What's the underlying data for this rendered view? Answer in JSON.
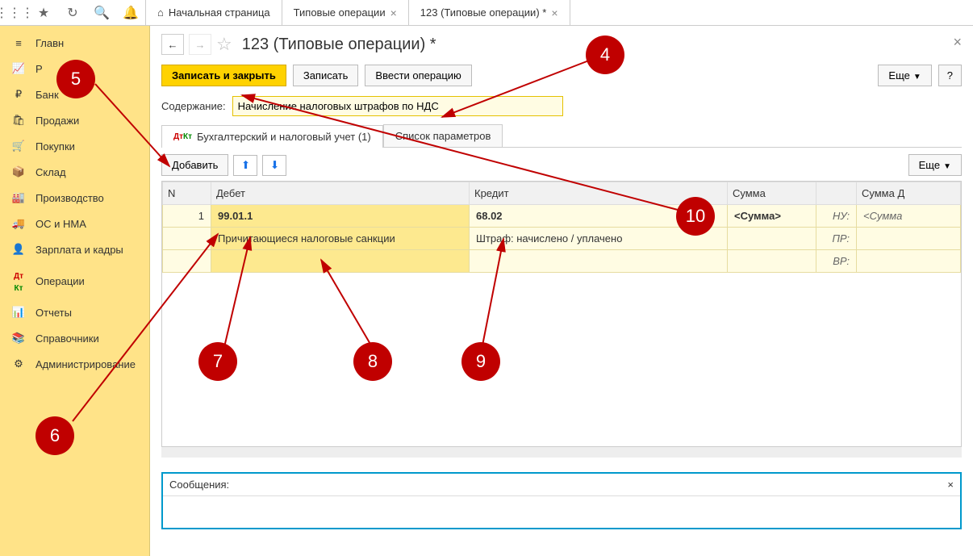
{
  "tabs": {
    "home": "Начальная страница",
    "tab1": "Типовые операции",
    "tab2": "123 (Типовые операции) *"
  },
  "sidebar": {
    "items": [
      {
        "icon": "≡",
        "label": "Главн"
      },
      {
        "icon": "~",
        "label": "Р"
      },
      {
        "icon": "₽",
        "label": "Банк"
      },
      {
        "icon": "🛍",
        "label": "Продажи"
      },
      {
        "icon": "🛒",
        "label": "Покупки"
      },
      {
        "icon": "📦",
        "label": "Склад"
      },
      {
        "icon": "🏭",
        "label": "Производство"
      },
      {
        "icon": "🚚",
        "label": "ОС и НМА"
      },
      {
        "icon": "👤",
        "label": "Зарплата и кадры"
      },
      {
        "icon": "ДтКт",
        "label": "Операции"
      },
      {
        "icon": "📊",
        "label": "Отчеты"
      },
      {
        "icon": "📚",
        "label": "Справочники"
      },
      {
        "icon": "⚙",
        "label": "Администрирование"
      }
    ]
  },
  "page": {
    "title": "123 (Типовые операции) *",
    "save_close": "Записать и закрыть",
    "save": "Записать",
    "enter_op": "Ввести операцию",
    "more": "Еще",
    "content_label": "Содержание:",
    "content_value": "Начисление налоговых штрафов по НДС",
    "tab_accounting": "Бухгалтерский и налоговый учет (1)",
    "tab_params": "Список параметров",
    "add": "Добавить",
    "headers": {
      "n": "N",
      "debit": "Дебет",
      "credit": "Кредит",
      "sum": "Сумма",
      "sumd": "Сумма Д"
    },
    "row": {
      "n": "1",
      "debit_acc": "99.01.1",
      "debit_sub": "Причитающиеся налоговые санкции",
      "credit_acc": "68.02",
      "credit_sub": "Штраф: начислено / уплачено",
      "sum": "<Сумма>",
      "nu": "НУ:",
      "pr": "ПР:",
      "vr": "ВР:",
      "sumd": "<Сумма"
    },
    "messages": "Сообщения:"
  },
  "bubbles": {
    "4": "4",
    "5": "5",
    "6": "6",
    "7": "7",
    "8": "8",
    "9": "9",
    "10": "10"
  }
}
